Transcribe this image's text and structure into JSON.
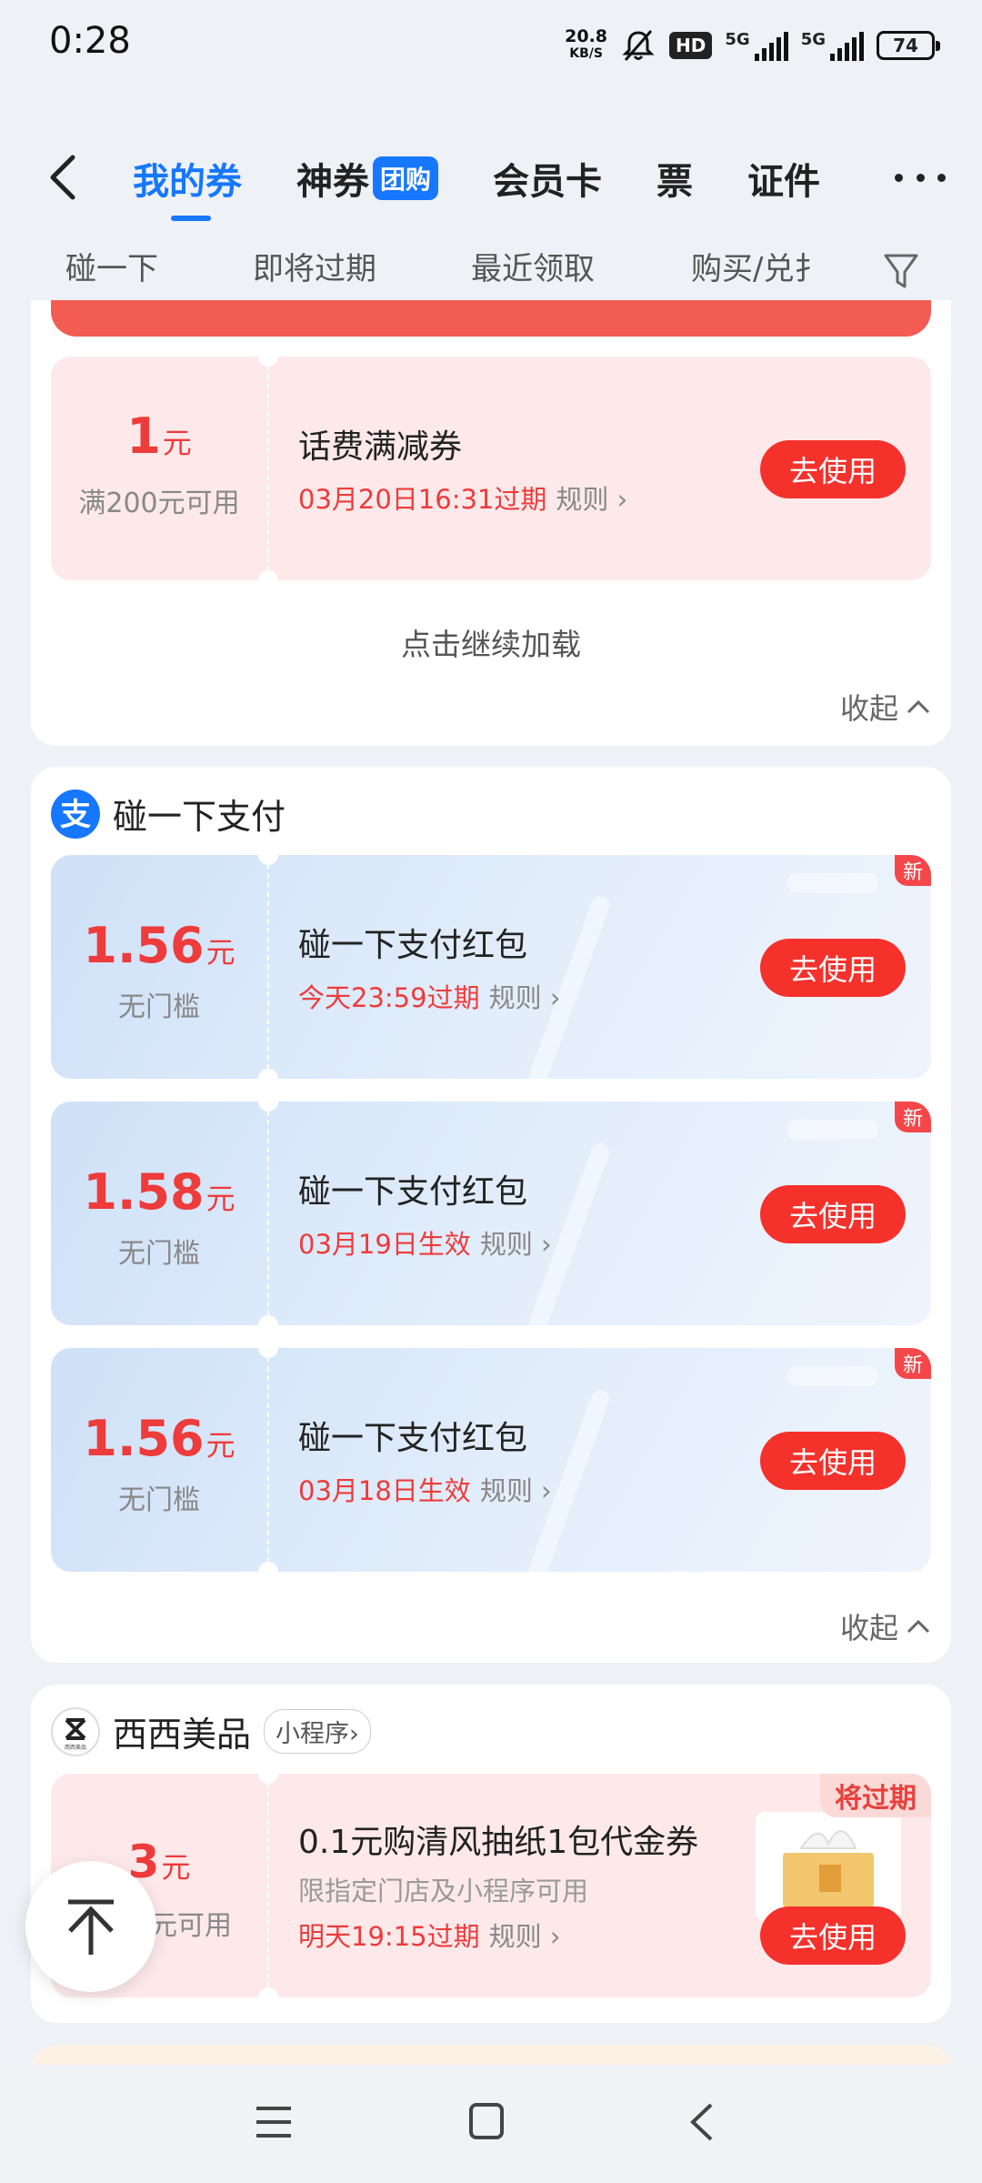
{
  "status": {
    "time": "0:28",
    "net_speed_top": "20.8",
    "net_speed_bottom": "KB/S",
    "hd": "HD",
    "sim1": "5G",
    "sim2": "5G",
    "battery": "74"
  },
  "nav": {
    "tabs": [
      {
        "label": "我的券"
      },
      {
        "label": "神券",
        "badge": "团购"
      },
      {
        "label": "会员卡"
      },
      {
        "label": "票"
      },
      {
        "label": "证件"
      }
    ]
  },
  "filters": [
    "碰一下",
    "即将过期",
    "最近领取",
    "购买/兑扌"
  ],
  "section1": {
    "coupon": {
      "amount": "1",
      "unit": "元",
      "condition": "满200元可用",
      "title": "话费满减券",
      "expire": "03月20日16:31过期",
      "rule": "规则",
      "button": "去使用"
    },
    "load_more": "点击继续加载",
    "collapse": "收起"
  },
  "section2": {
    "title": "碰一下支付",
    "coupons": [
      {
        "amount": "1.56",
        "unit": "元",
        "condition": "无门槛",
        "title": "碰一下支付红包",
        "expire": "今天23:59过期",
        "rule": "规则",
        "button": "去使用",
        "badge": "新"
      },
      {
        "amount": "1.58",
        "unit": "元",
        "condition": "无门槛",
        "title": "碰一下支付红包",
        "expire": "03月19日生效",
        "rule": "规则",
        "button": "去使用",
        "badge": "新"
      },
      {
        "amount": "1.56",
        "unit": "元",
        "condition": "无门槛",
        "title": "碰一下支付红包",
        "expire": "03月18日生效",
        "rule": "规则",
        "button": "去使用",
        "badge": "新"
      }
    ],
    "collapse": "收起"
  },
  "section3": {
    "title": "西西美品",
    "tag": "小程序",
    "logo_text": "西西美品",
    "coupon": {
      "amount": "3",
      "unit": "元",
      "condition": "元可用",
      "title": "0.1元购清风抽纸1包代金券",
      "subtitle": "限指定门店及小程序可用",
      "expire": "明天19:15过期",
      "rule": "规则",
      "button": "去使用",
      "badge": "将过期"
    }
  },
  "colors": {
    "accent": "#1677ff",
    "red": "#f5312c",
    "pink_coupon": "#fde9ea",
    "blue_coupon": "#d6e6fa"
  }
}
